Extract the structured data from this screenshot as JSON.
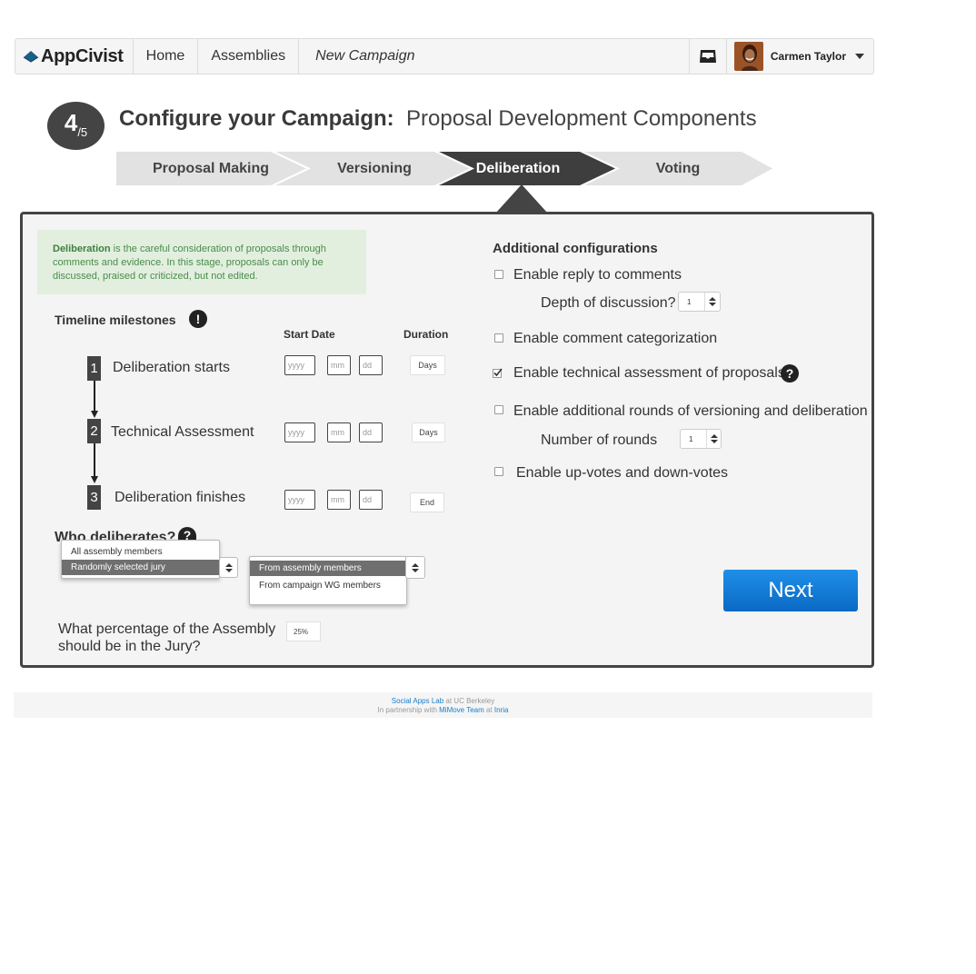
{
  "navbar": {
    "brand": "AppCivist",
    "home": "Home",
    "assemblies": "Assemblies",
    "current": "New Campaign",
    "user_name": "Carmen Taylor"
  },
  "step": {
    "number": "4",
    "total": "/5"
  },
  "title": {
    "main": "Configure your Campaign:",
    "sub": "Proposal Development Components"
  },
  "stages": [
    {
      "label": "Proposal Making",
      "active": false
    },
    {
      "label": "Versioning",
      "active": false
    },
    {
      "label": "Deliberation",
      "active": true
    },
    {
      "label": "Voting",
      "active": false
    }
  ],
  "info": {
    "term": "Deliberation",
    "text": " is the careful consideration of proposals through comments and evidence. In this stage, proposals can only be discussed, praised or criticized, but not edited."
  },
  "timeline": {
    "heading": "Timeline milestones",
    "col_start": "Start Date",
    "col_duration": "Duration",
    "placeholders": {
      "year": "yyyy",
      "month": "mm",
      "day": "dd"
    },
    "milestones": [
      {
        "num": "1",
        "label": "Deliberation starts",
        "duration": "Days"
      },
      {
        "num": "2",
        "label": "Technical Assessment",
        "duration": "Days"
      },
      {
        "num": "3",
        "label": "Deliberation finishes",
        "duration": "End"
      }
    ]
  },
  "who": {
    "heading": "Who deliberates?",
    "options_a": [
      "All assembly members",
      "Randomly selected jury"
    ],
    "selected_a": "Randomly selected jury",
    "options_b": [
      "From assembly members",
      "From campaign WG members"
    ],
    "selected_b": "From assembly members",
    "jury_question_line1": "What percentage of the Assembly",
    "jury_question_line2": "should be in the Jury?",
    "jury_percentage": "25%"
  },
  "additional": {
    "heading": "Additional configurations",
    "reply": {
      "label": "Enable reply to comments",
      "checked": false
    },
    "depth_label": "Depth of discussion?",
    "depth_value": "1",
    "categorization": {
      "label": "Enable comment categorization",
      "checked": false
    },
    "technical": {
      "label": "Enable technical assessment of proposals",
      "checked": true
    },
    "rounds": {
      "label": "Enable additional rounds of versioning and deliberation",
      "checked": false
    },
    "rounds_label": "Number of rounds",
    "rounds_value": "1",
    "votes": {
      "label": "Enable up-votes and down-votes",
      "checked": false
    }
  },
  "next_label": "Next",
  "footer": {
    "lab": "Social Apps Lab",
    "at1": " at UC Berkeley",
    "partnership": "In partnership with ",
    "team": "MiMove Team",
    "at2": " at ",
    "inria": "Inria"
  },
  "colors": {
    "dark": "#444444",
    "info_bg": "#e2efdf",
    "info_text": "#4a8c4a",
    "next_button": "#0a69c4",
    "link": "#1a7ec8"
  }
}
